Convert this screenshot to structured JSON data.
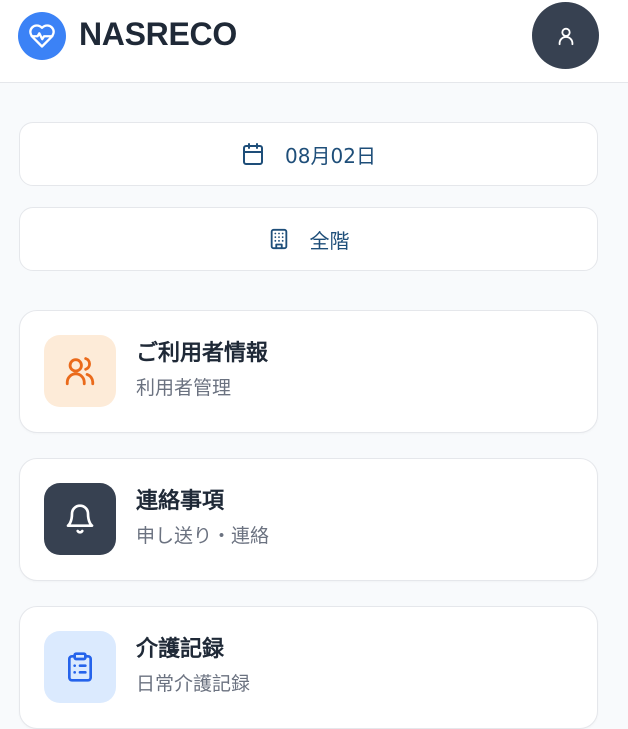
{
  "header": {
    "brand_name": "NASRECO",
    "logo_icon": "heart-pulse-icon",
    "avatar_icon": "user-icon"
  },
  "selectors": {
    "date": {
      "label": "08月02日",
      "icon": "calendar-icon"
    },
    "floor": {
      "label": "全階",
      "icon": "building-icon"
    }
  },
  "menu": [
    {
      "title": "ご利用者情報",
      "subtitle": "利用者管理",
      "icon": "users-icon",
      "tile_color": "#fdebd8",
      "icon_color": "#ea6a1b"
    },
    {
      "title": "連絡事項",
      "subtitle": "申し送り・連絡",
      "icon": "bell-icon",
      "tile_color": "#374151",
      "icon_color": "#ffffff"
    },
    {
      "title": "介護記録",
      "subtitle": "日常介護記録",
      "icon": "clipboard-icon",
      "tile_color": "#dbeafe",
      "icon_color": "#2563eb"
    }
  ],
  "colors": {
    "brand": "#3b82f6",
    "accent_text": "#1e4e79"
  }
}
